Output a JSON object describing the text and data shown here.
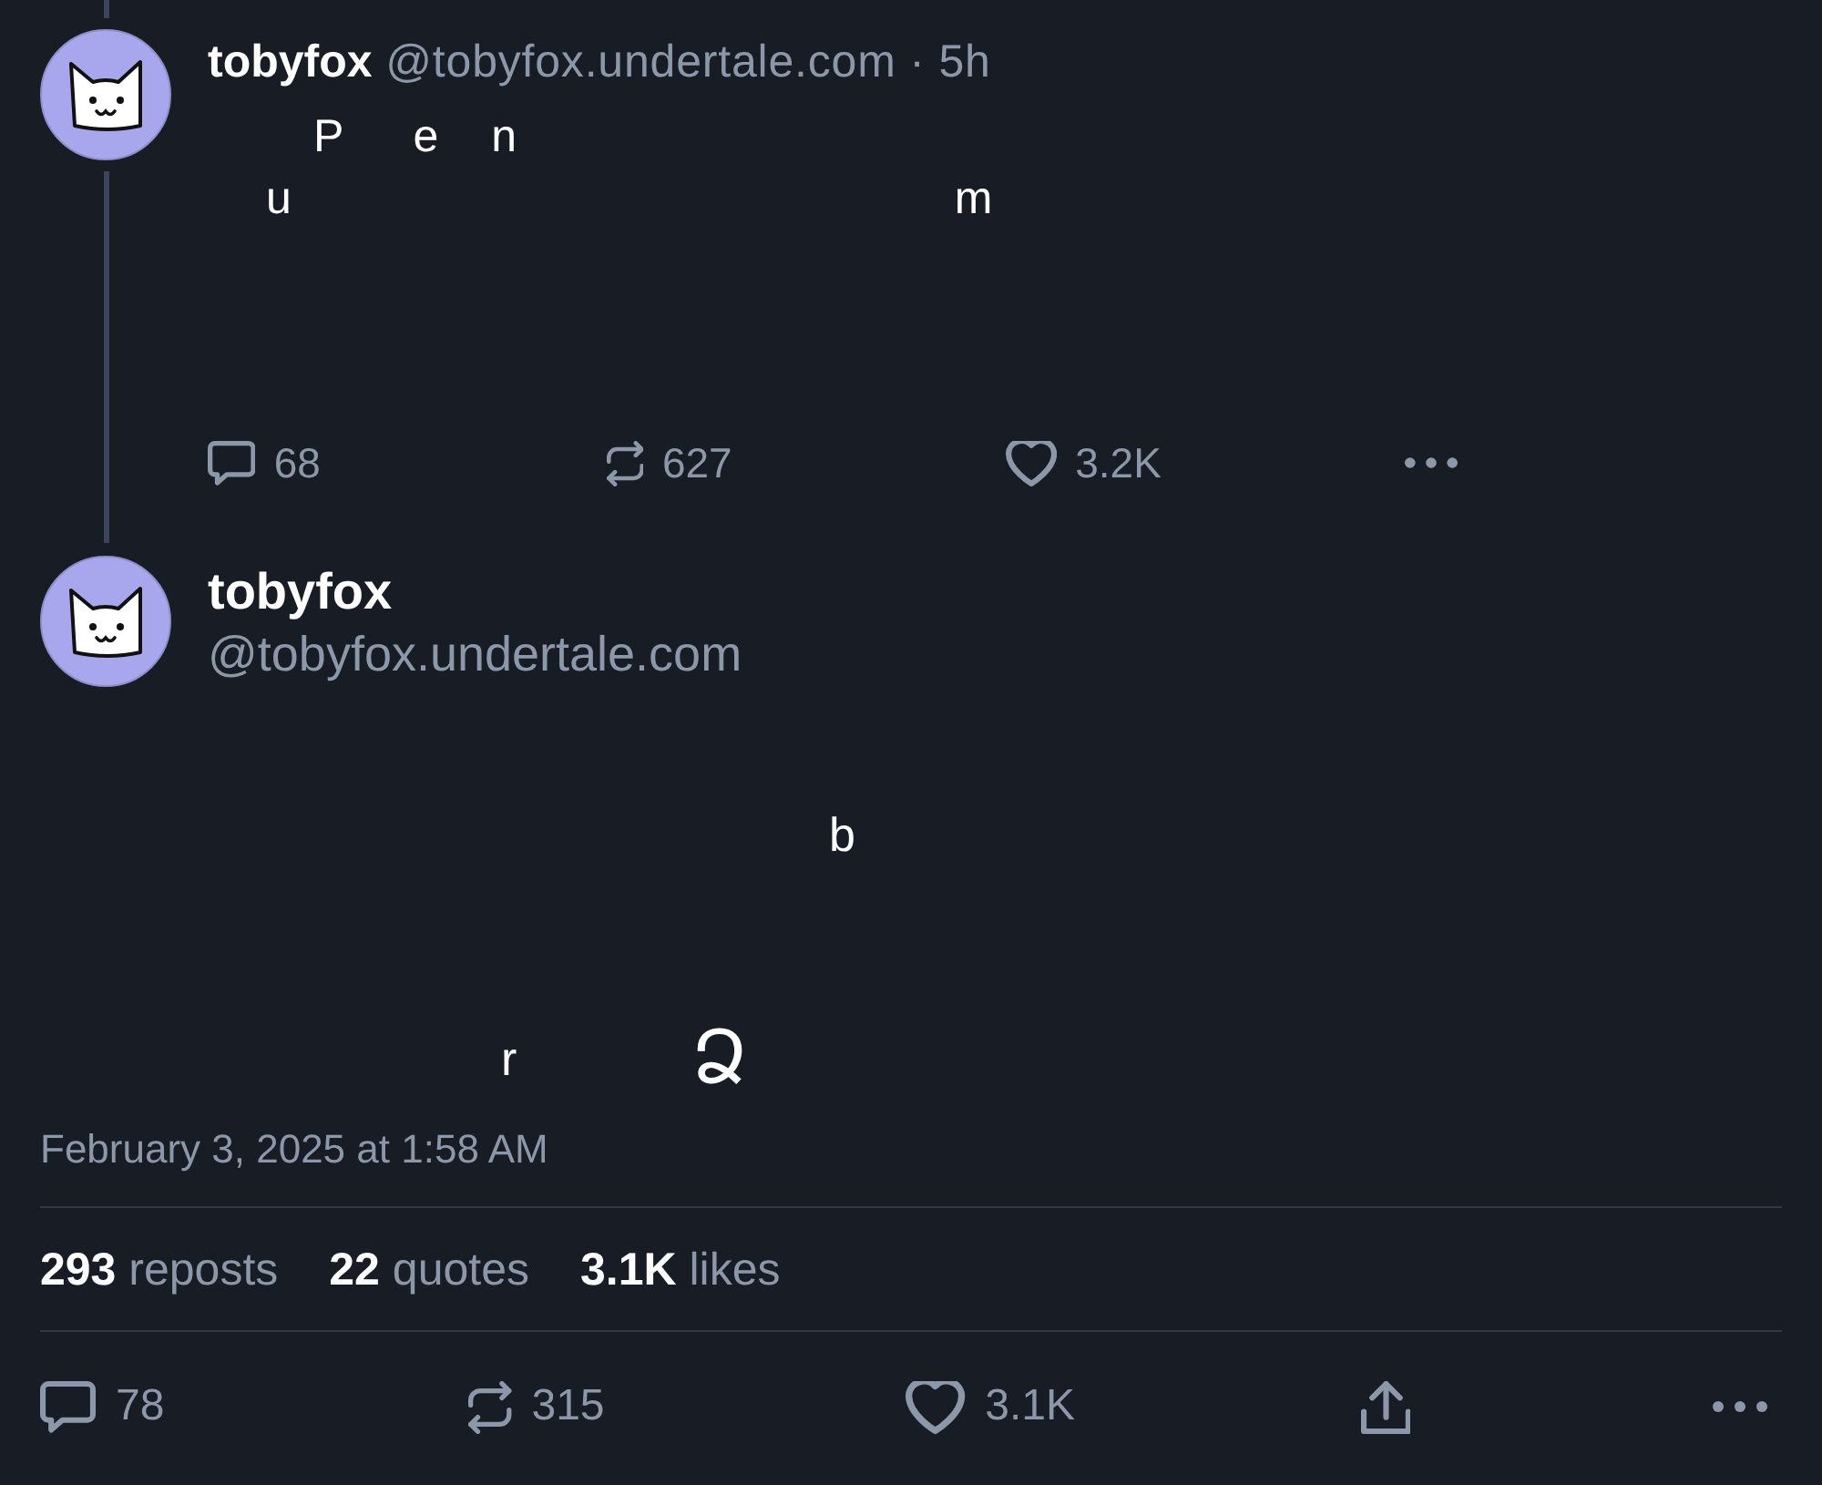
{
  "parent_post": {
    "author": {
      "display_name": "tobyfox",
      "handle": "@tobyfox.undertale.com",
      "time": "· 5h"
    },
    "text_lines": [
      [
        "P",
        "e",
        "n"
      ],
      [
        "u",
        "m"
      ]
    ],
    "actions": [
      {
        "kind": "reply",
        "count": "68"
      },
      {
        "kind": "repost",
        "count": "627"
      },
      {
        "kind": "like",
        "count": "3.2K"
      },
      {
        "kind": "more"
      }
    ]
  },
  "main_post": {
    "author": {
      "display_name": "tobyfox",
      "handle": "@tobyfox.undertale.com"
    },
    "text_lines": [
      [
        "b"
      ],
      [
        "r",
        "Ձ"
      ]
    ],
    "timestamp": "February 3, 2025 at 1:58 AM",
    "stats": [
      {
        "count": "293",
        "label": "reposts"
      },
      {
        "count": "22",
        "label": "quotes"
      },
      {
        "count": "3.1K",
        "label": "likes"
      }
    ],
    "actions": [
      {
        "kind": "reply",
        "count": "78"
      },
      {
        "kind": "repost",
        "count": "315"
      },
      {
        "kind": "like",
        "count": "3.1K"
      },
      {
        "kind": "share"
      },
      {
        "kind": "more"
      }
    ]
  }
}
